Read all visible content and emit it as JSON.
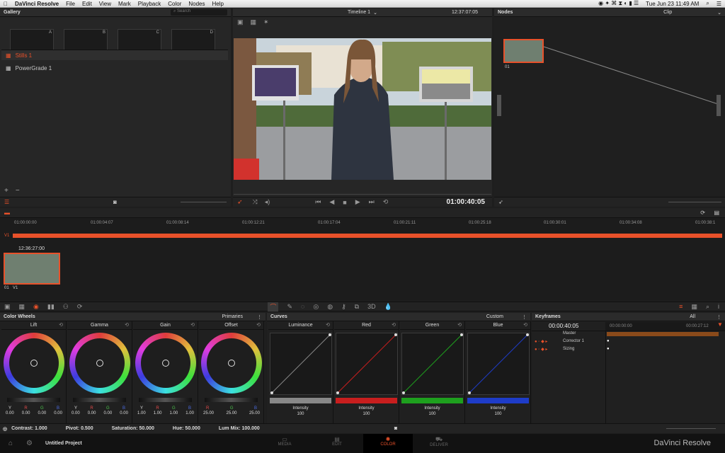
{
  "menubar": {
    "app": "DaVinci Resolve",
    "items": [
      "File",
      "Edit",
      "View",
      "Mark",
      "Playback",
      "Color",
      "Nodes",
      "Help"
    ],
    "clock": "Tue Jun 23  11:49 AM"
  },
  "gallery": {
    "title": "Gallery",
    "search": "Search",
    "slots": [
      "A",
      "B",
      "C",
      "D"
    ],
    "albums": [
      "Stills 1",
      "PowerGrade 1"
    ]
  },
  "viewer": {
    "timeline": "Timeline 1",
    "timecode_top": "12:37:07:05",
    "timecode": "01:00:40:05"
  },
  "nodes": {
    "title": "Nodes",
    "clip": "Clip",
    "node_label": "01"
  },
  "timeline": {
    "ruler": [
      "01:00:00:00",
      "01:00:04:07",
      "01:00:08:14",
      "01:00:12:21",
      "01:00:17:04",
      "01:00:21:11",
      "01:00:25:18",
      "01:00:30:01",
      "01:00:34:08",
      "01:00:38:1"
    ],
    "track": "V1",
    "clip_tc": "12:36:27:00",
    "clip_num": "01",
    "clip_track": "V1"
  },
  "colorwheels": {
    "title": "Color Wheels",
    "mode": "Primaries",
    "wheels": [
      {
        "name": "Lift",
        "labels": [
          "Y",
          "R",
          "G",
          "B"
        ],
        "values": [
          "0.00",
          "0.00",
          "0.00",
          "0.00"
        ]
      },
      {
        "name": "Gamma",
        "labels": [
          "Y",
          "R",
          "G",
          "B"
        ],
        "values": [
          "0.00",
          "0.00",
          "0.00",
          "0.00"
        ]
      },
      {
        "name": "Gain",
        "labels": [
          "Y",
          "R",
          "G",
          "B"
        ],
        "values": [
          "1.00",
          "1.00",
          "1.00",
          "1.00"
        ]
      },
      {
        "name": "Offset",
        "labels": [
          "R",
          "G",
          "B"
        ],
        "values": [
          "25.00",
          "25.00",
          "25.00"
        ]
      }
    ]
  },
  "curves": {
    "title": "Curves",
    "mode": "Custom",
    "channels": [
      {
        "name": "Luminance",
        "intensity_label": "Intensity",
        "intensity": "100",
        "color": "#888888"
      },
      {
        "name": "Red",
        "intensity_label": "Intensity",
        "intensity": "100",
        "color": "#c81e1e"
      },
      {
        "name": "Green",
        "intensity_label": "Intensity",
        "intensity": "100",
        "color": "#1ea01e"
      },
      {
        "name": "Blue",
        "intensity_label": "Intensity",
        "intensity": "100",
        "color": "#1e3cc8"
      }
    ]
  },
  "keyframes": {
    "title": "Keyframes",
    "filter": "All",
    "tc": "00:00:40:05",
    "start": "00:00:00:00",
    "end": "00:00:27:12",
    "rows": [
      "Master",
      "Corrector 1",
      "Sizing"
    ]
  },
  "bottombar": {
    "contrast": "Contrast: 1.000",
    "pivot": "Pivot: 0.500",
    "saturation": "Saturation: 50.000",
    "hue": "Hue: 50.000",
    "lummix": "Lum Mix: 100.000"
  },
  "footer": {
    "project": "Untitled Project",
    "pages": [
      "MEDIA",
      "EDIT",
      "COLOR",
      "DELIVER"
    ],
    "brand": "DaVinci Resolve"
  }
}
